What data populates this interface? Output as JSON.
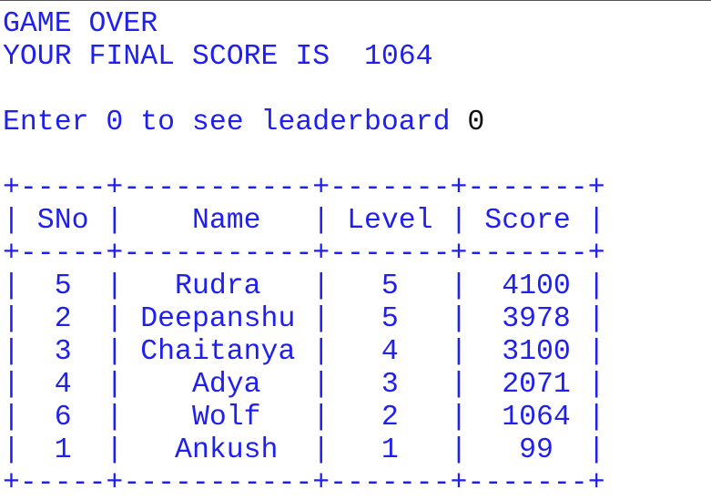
{
  "game_over_text": "GAME OVER",
  "final_score_label": "YOUR FINAL SCORE IS ",
  "final_score": "1064",
  "prompt_text": "Enter 0 to see leaderboard ",
  "user_input": "0",
  "table": {
    "columns": [
      "SNo",
      "Name",
      "Level",
      "Score"
    ],
    "rows": [
      [
        "5",
        "Rudra",
        "5",
        "4100"
      ],
      [
        "2",
        "Deepanshu",
        "5",
        "3978"
      ],
      [
        "3",
        "Chaitanya",
        "4",
        "3100"
      ],
      [
        "4",
        "Adya",
        "3",
        "2071"
      ],
      [
        "6",
        "Wolf",
        "2",
        "1064"
      ],
      [
        "1",
        "Ankush",
        "1",
        "99"
      ]
    ]
  },
  "colors": {
    "console_text": "#2020ee",
    "echoed_input": "#111111"
  }
}
